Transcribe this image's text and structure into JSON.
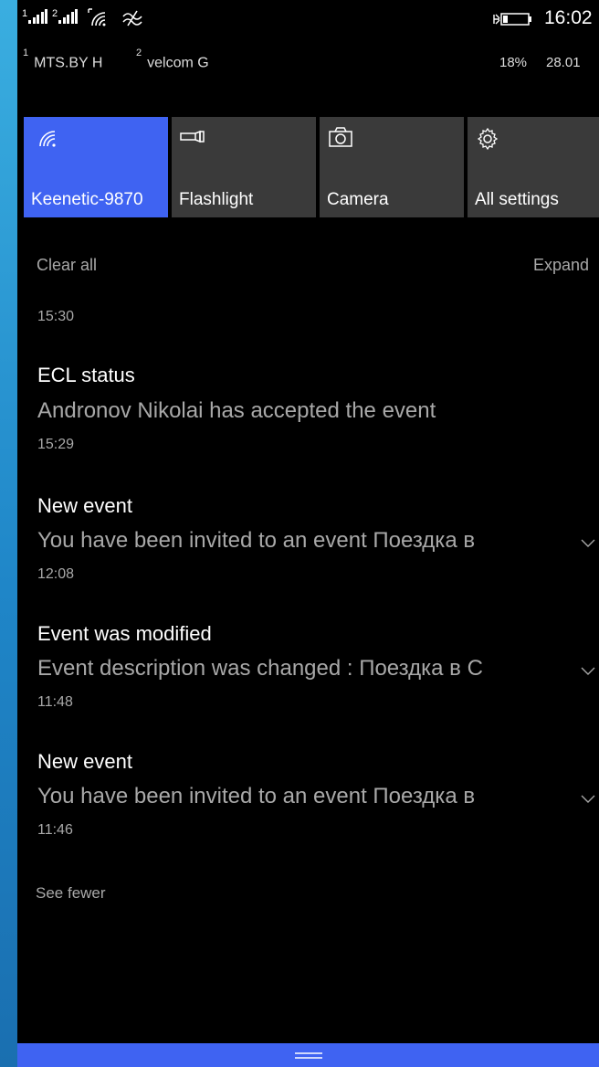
{
  "status_bar": {
    "sim1_index": "1",
    "sim2_index": "2",
    "carrier1": "MTS.BY H",
    "carrier2": "velcom G",
    "time": "16:02",
    "battery_percent": "18%",
    "date": "28.01"
  },
  "quick_actions": [
    {
      "label": "Keenetic-9870",
      "icon": "wifi-icon",
      "active": true
    },
    {
      "label": "Flashlight",
      "icon": "flashlight-icon",
      "active": false
    },
    {
      "label": "Camera",
      "icon": "camera-icon",
      "active": false
    },
    {
      "label": "All settings",
      "icon": "gear-icon",
      "active": false
    }
  ],
  "action_center": {
    "clear_all": "Clear all",
    "expand": "Expand",
    "see_fewer": "See fewer",
    "group_time": "15:30"
  },
  "notifications": [
    {
      "title": "ECL status",
      "body": "Andronov Nikolai has accepted the event",
      "time": "15:29",
      "expandable": false
    },
    {
      "title": "New event",
      "body": "You have been invited to an event Поездка в",
      "time": "12:08",
      "expandable": true
    },
    {
      "title": "Event was modified",
      "body": "Event description was changed : Поездка в С",
      "time": "11:48",
      "expandable": true
    },
    {
      "title": "New event",
      "body": "You have been invited to an event Поездка в",
      "time": "11:46",
      "expandable": true
    }
  ],
  "colors": {
    "accent": "#3f63f2",
    "tile_inactive": "#3a3a3a",
    "background": "#000000",
    "secondary_text": "#a8a8a8"
  }
}
